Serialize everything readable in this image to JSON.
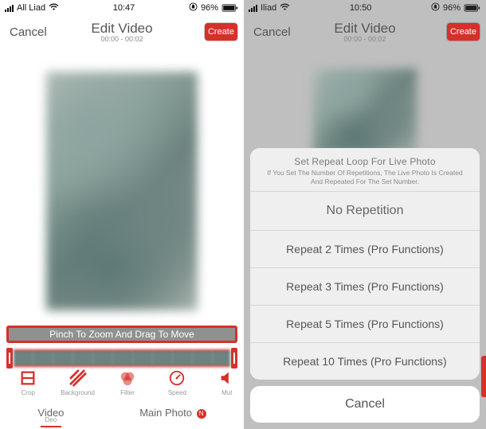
{
  "left": {
    "status": {
      "carrier": "All Liad",
      "time": "10:47",
      "battery_text": "96%"
    },
    "nav": {
      "cancel": "Cancel",
      "title": "Edit Video",
      "time_range": "00:00 - 00:02",
      "create": "Create"
    },
    "hint": "Pinch To Zoom And Drag To Move",
    "tools": {
      "crop": "Crop",
      "background": "Background",
      "filter": "Filter",
      "speed": "Speed",
      "mute": "Mut"
    },
    "bottom": {
      "video": "Video",
      "video_sub": "Deo",
      "main_photo": "Main Photo",
      "new_badge": "N"
    }
  },
  "right": {
    "status": {
      "carrier": "Iliad",
      "time": "10:50",
      "battery_text": "96%"
    },
    "nav": {
      "cancel": "Cancel",
      "title": "Edit Video",
      "time_range": "00:00 - 00:02",
      "create": "Create"
    },
    "sheet": {
      "title": "Set Repeat Loop For Live Photo",
      "desc_line1": "If You Set The Number Of Repetitions, The Live Photo Is Created",
      "desc_line2": "And Repeated For The Set Number.",
      "items": {
        "none": "No Repetition",
        "r2": "Repeat 2 Times (Pro Functions)",
        "r3": "Repeat 3 Times (Pro Functions)",
        "r5": "Repeat 5 Times (Pro Functions)",
        "r10": "Repeat 10 Times (Pro Functions)"
      },
      "cancel": "Cancel"
    }
  }
}
